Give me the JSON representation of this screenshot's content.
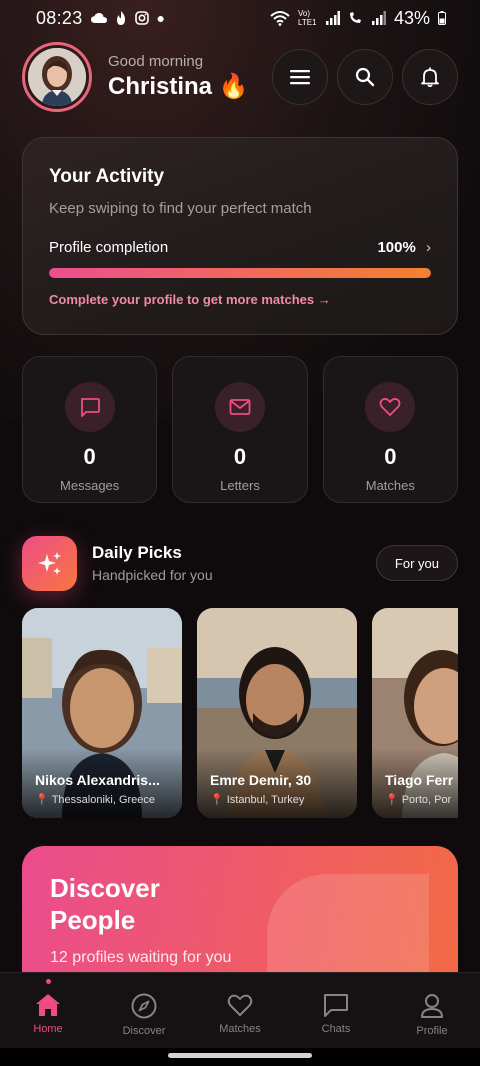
{
  "status_bar": {
    "time": "08:23",
    "signal_text": "Vo) LTE1",
    "battery": "43%"
  },
  "header": {
    "greeting": "Good morning",
    "name": "Christina",
    "name_emoji": "🔥",
    "icons": [
      "menu-icon",
      "search-icon",
      "bell-icon"
    ]
  },
  "activity": {
    "title": "Your Activity",
    "subtitle": "Keep swiping to find your perfect match",
    "completion_label": "Profile completion",
    "completion_value": "100%",
    "completion_fraction": 1.0,
    "cta": "Complete your profile to get more matches →"
  },
  "stats": [
    {
      "icon": "message-icon",
      "value": "0",
      "label": "Messages"
    },
    {
      "icon": "envelope-icon",
      "value": "0",
      "label": "Letters"
    },
    {
      "icon": "heart-icon",
      "value": "0",
      "label": "Matches"
    }
  ],
  "daily_picks": {
    "title": "Daily Picks",
    "subtitle": "Handpicked for you",
    "filter_label": "For you",
    "picks": [
      {
        "name": "Nikos Alexandris...",
        "location": "Thessaloniki, Greece"
      },
      {
        "name": "Emre Demir, 30",
        "location": "Istanbul, Turkey"
      },
      {
        "name": "Tiago Ferr",
        "location": "Porto, Por"
      }
    ]
  },
  "discover": {
    "title": "Discover People",
    "subtitle": "12 profiles waiting for you"
  },
  "bottom_nav": [
    {
      "label": "Home",
      "icon": "home-icon",
      "active": true
    },
    {
      "label": "Discover",
      "icon": "compass-icon",
      "active": false
    },
    {
      "label": "Matches",
      "icon": "heart-icon",
      "active": false
    },
    {
      "label": "Chats",
      "icon": "chat-icon",
      "active": false
    },
    {
      "label": "Profile",
      "icon": "user-icon",
      "active": false
    }
  ],
  "colors": {
    "accent_pink": "#ee4e7f",
    "accent_orange": "#f5812f",
    "background": "#0f0b0c"
  }
}
